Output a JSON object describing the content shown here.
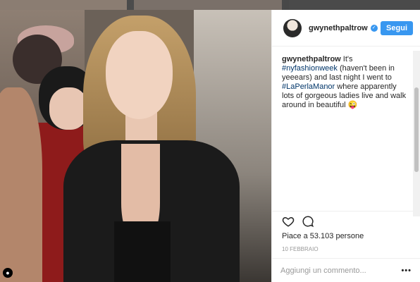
{
  "header": {
    "username": "gwynethpaltrow",
    "verified_icon": "verified-badge-icon",
    "follow_label": "Segui",
    "accent": "#3897f0"
  },
  "caption": {
    "username": "gwynethpaltrow",
    "text_1": " It's ",
    "hashtag_1": "#nyfashionweek",
    "text_2": " (haven't been in yeeears) and last night I went to ",
    "hashtag_2": "#LaPerlaManor",
    "text_3": " where apparently lots of gorgeous ladies live and walk around in beautiful ",
    "emoji": "😜"
  },
  "actions": {
    "like_icon": "heart-icon",
    "comment_icon": "comment-icon"
  },
  "likes_text": "Piace a 53.103 persone",
  "date_text": "10 FEBBRAIO",
  "comment": {
    "placeholder": "Aggiungi un commento...",
    "more_icon": "more-options-icon",
    "more_label": "•••"
  },
  "photo": {
    "user_tag_icon": "user-tag-icon"
  }
}
